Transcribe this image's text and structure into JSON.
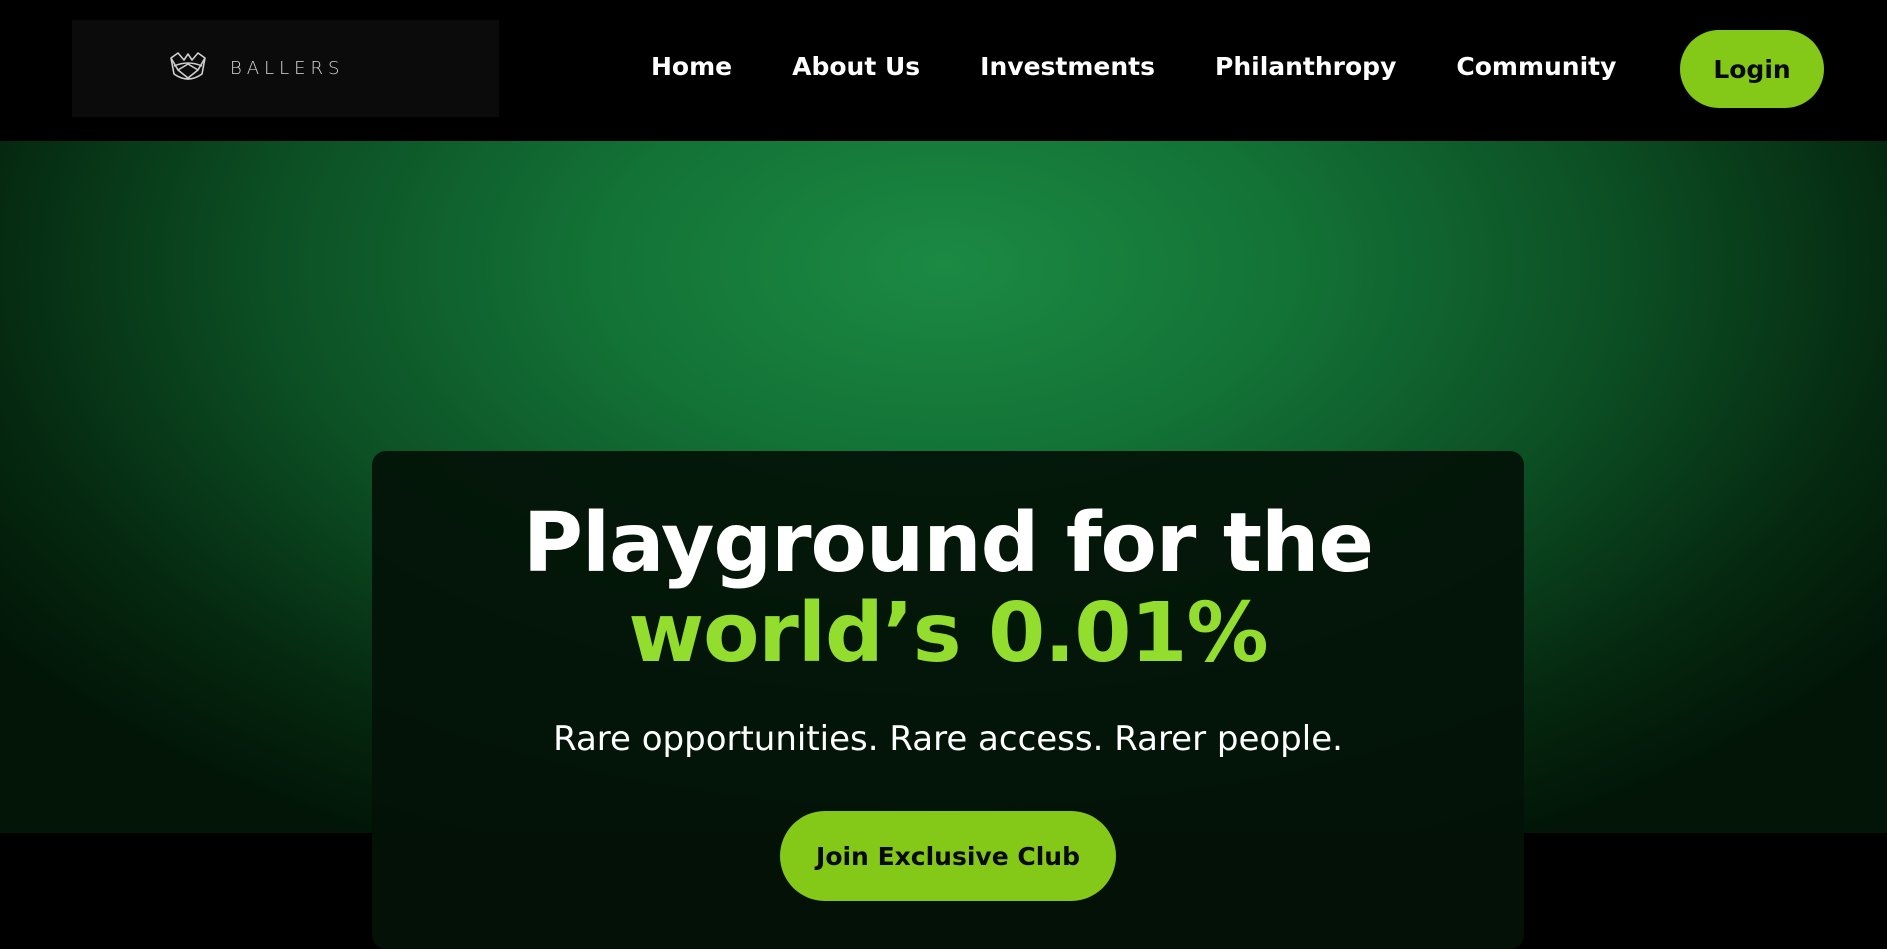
{
  "brand": {
    "name": "BALLERS",
    "logo_icon": "crown-mask-icon"
  },
  "nav": {
    "items": [
      {
        "label": "Home"
      },
      {
        "label": "About Us"
      },
      {
        "label": "Investments"
      },
      {
        "label": "Philanthropy"
      },
      {
        "label": "Community"
      }
    ],
    "login_label": "Login"
  },
  "hero": {
    "headline_line1": "Playground for the",
    "headline_line2": "world’s 0.01%",
    "subtitle": "Rare opportunities. Rare access. Rarer people.",
    "cta_label": "Join Exclusive Club"
  },
  "colors": {
    "accent": "#84c818",
    "highlight": "#93dd2e",
    "hero_glow": "#1b8a43",
    "background": "#000000"
  }
}
